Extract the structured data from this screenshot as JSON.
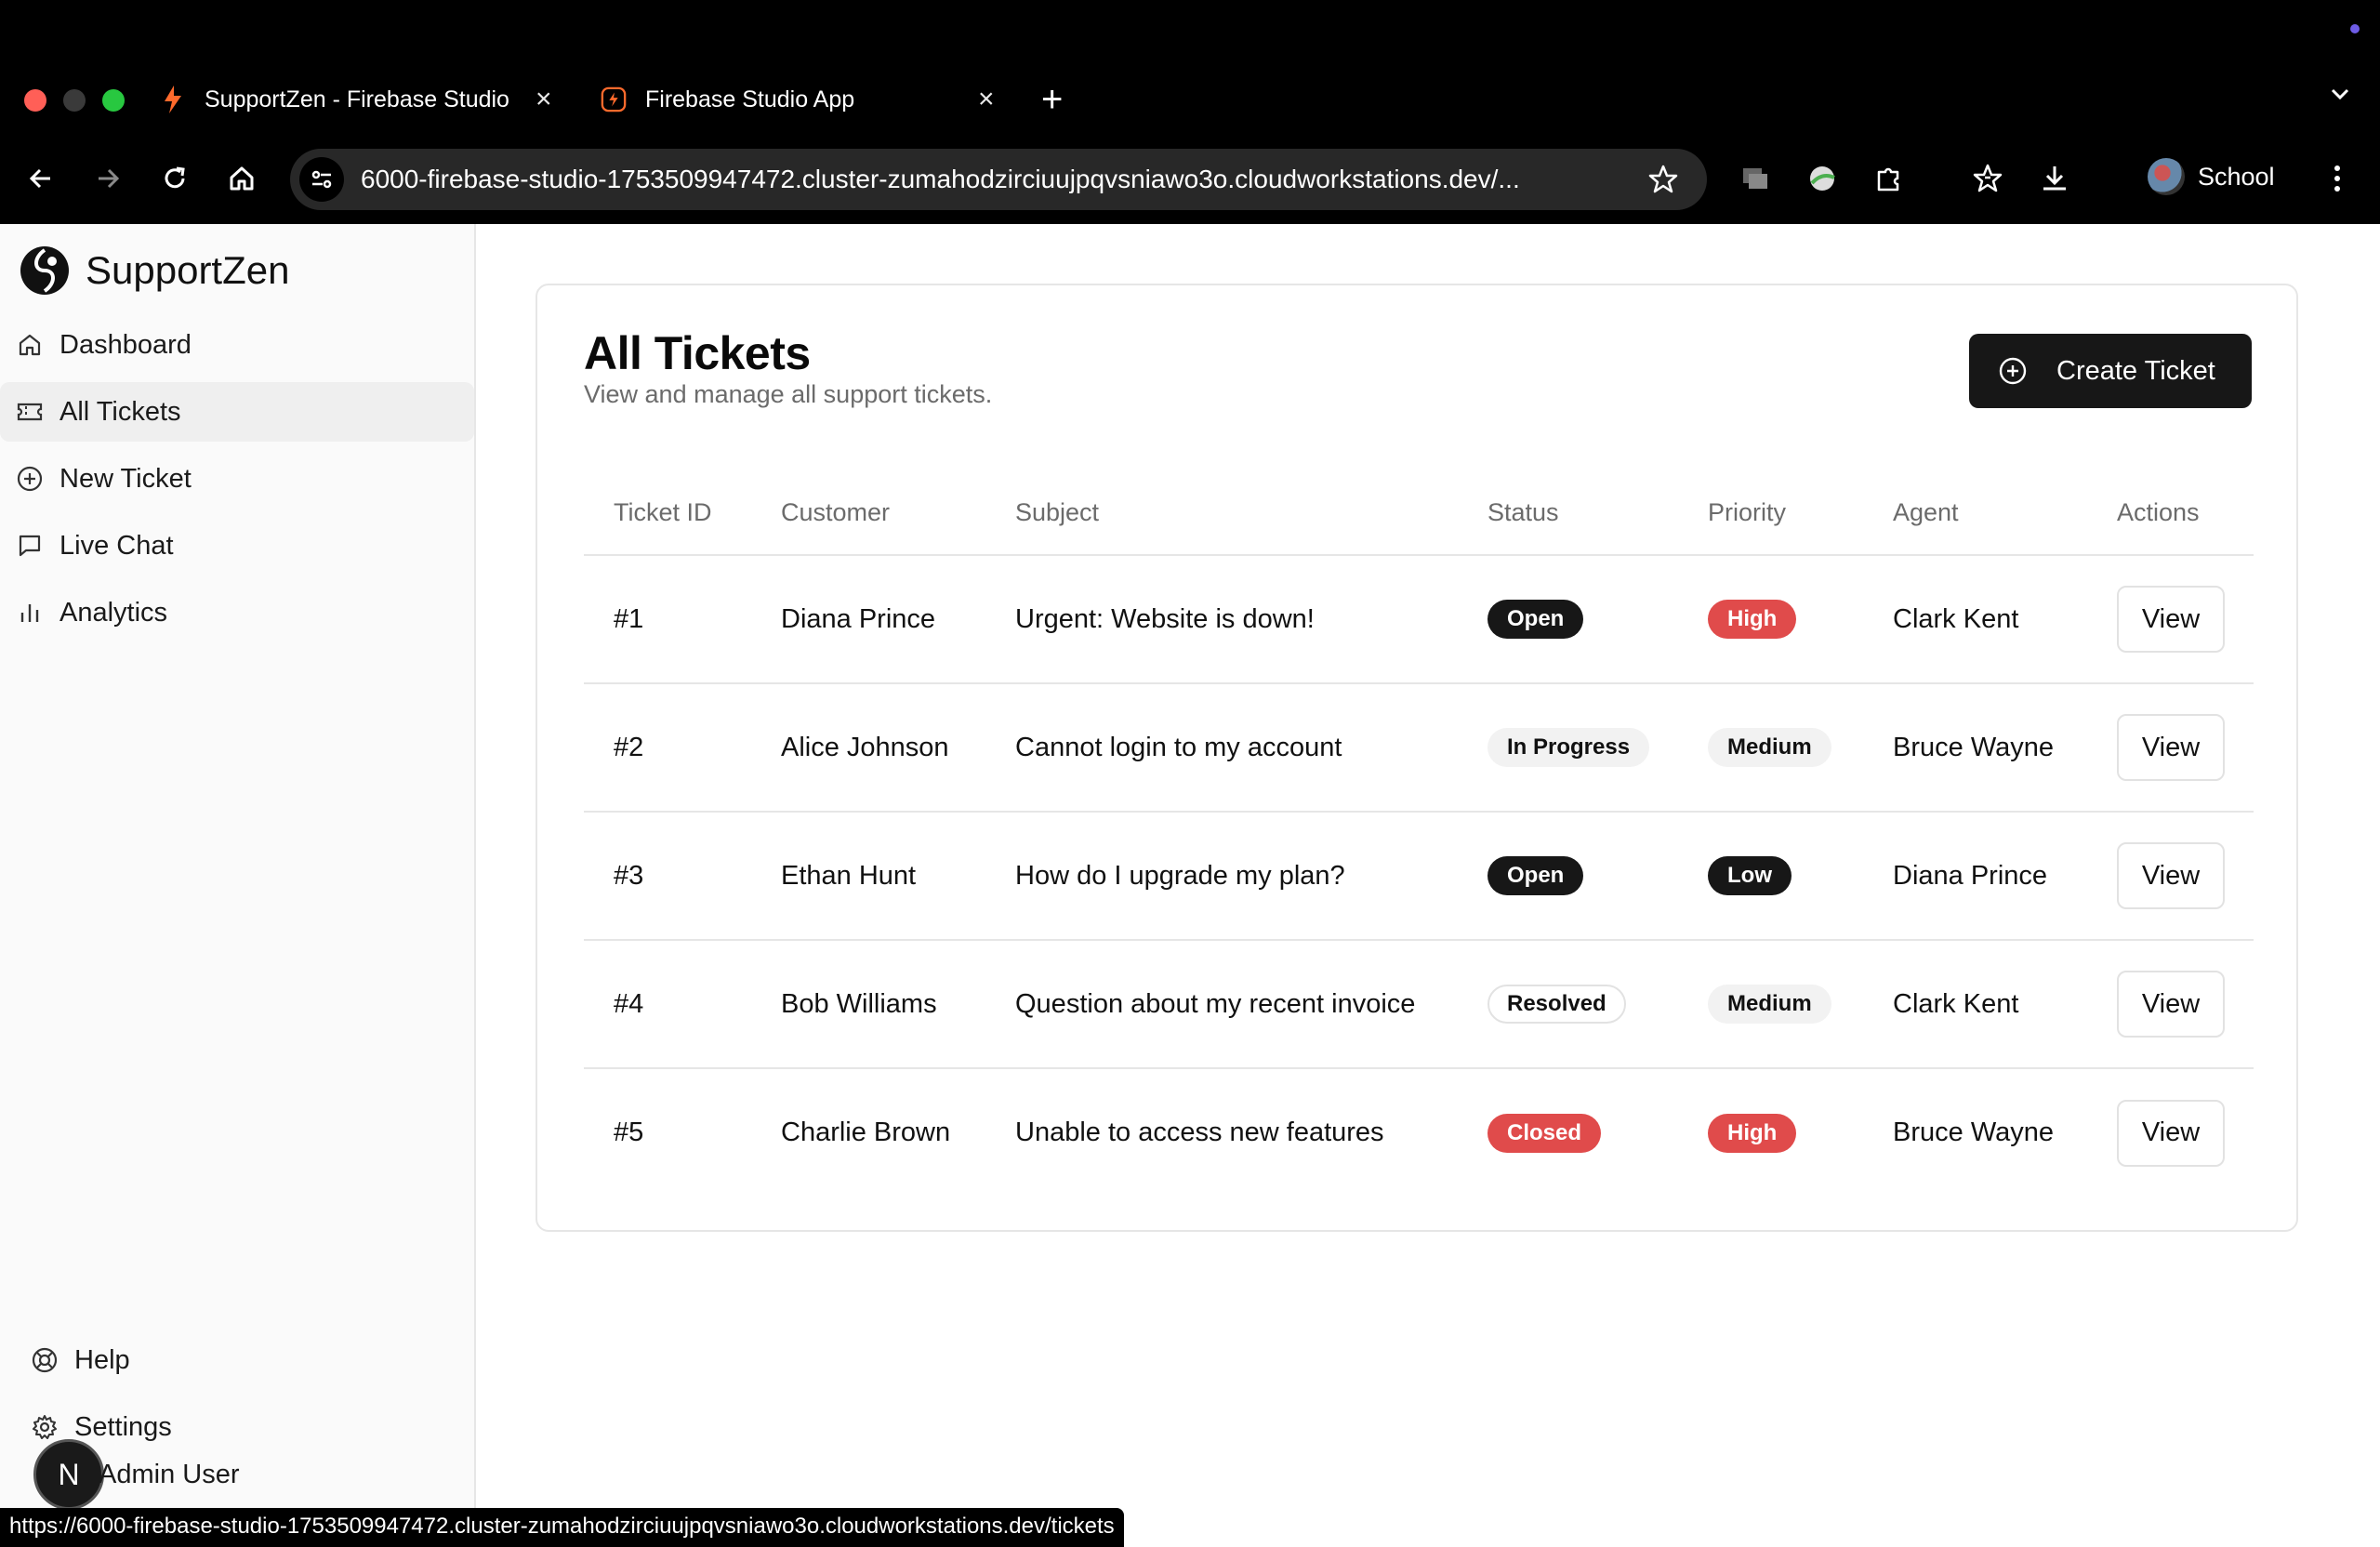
{
  "browser": {
    "tabs": [
      {
        "title": "SupportZen - Firebase Studio",
        "active": true
      },
      {
        "title": "Firebase Studio App",
        "active": false
      }
    ],
    "url": "6000-firebase-studio-1753509947472.cluster-zumahodzirciuujpqvsniawo3o.cloudworkstations.dev/...",
    "profile_label": "School",
    "status_url": "https://6000-firebase-studio-1753509947472.cluster-zumahodzirciuujpqvsniawo3o.cloudworkstations.dev/tickets"
  },
  "sidebar": {
    "brand": "SupportZen",
    "items": [
      {
        "label": "Dashboard",
        "icon": "home-icon"
      },
      {
        "label": "All Tickets",
        "icon": "ticket-icon",
        "active": true
      },
      {
        "label": "New Ticket",
        "icon": "plus-circle-icon"
      },
      {
        "label": "Live Chat",
        "icon": "chat-icon"
      },
      {
        "label": "Analytics",
        "icon": "bar-chart-icon"
      }
    ],
    "bottom_items": [
      {
        "label": "Help",
        "icon": "lifebuoy-icon"
      },
      {
        "label": "Settings",
        "icon": "gear-icon"
      }
    ],
    "user": {
      "initial": "N",
      "name": "Admin User"
    }
  },
  "main": {
    "title": "All Tickets",
    "subtitle": "View and manage all support tickets.",
    "create_label": "Create Ticket",
    "columns": [
      "Ticket ID",
      "Customer",
      "Subject",
      "Status",
      "Priority",
      "Agent",
      "Actions"
    ],
    "rows": [
      {
        "id": "#1",
        "customer": "Diana Prince",
        "subject": "Urgent: Website is down!",
        "status": "Open",
        "priority": "High",
        "agent": "Clark Kent",
        "action": "View"
      },
      {
        "id": "#2",
        "customer": "Alice Johnson",
        "subject": "Cannot login to my account",
        "status": "In Progress",
        "priority": "Medium",
        "agent": "Bruce Wayne",
        "action": "View"
      },
      {
        "id": "#3",
        "customer": "Ethan Hunt",
        "subject": "How do I upgrade my plan?",
        "status": "Open",
        "priority": "Low",
        "agent": "Diana Prince",
        "action": "View"
      },
      {
        "id": "#4",
        "customer": "Bob Williams",
        "subject": "Question about my recent invoice",
        "status": "Resolved",
        "priority": "Medium",
        "agent": "Clark Kent",
        "action": "View"
      },
      {
        "id": "#5",
        "customer": "Charlie Brown",
        "subject": "Unable to access new features",
        "status": "Closed",
        "priority": "High",
        "agent": "Bruce Wayne",
        "action": "View"
      }
    ]
  },
  "colors": {
    "accent": "#171717",
    "danger": "#e04b4b",
    "muted": "#6b6b6b",
    "sidebar_bg": "#fafafa"
  }
}
